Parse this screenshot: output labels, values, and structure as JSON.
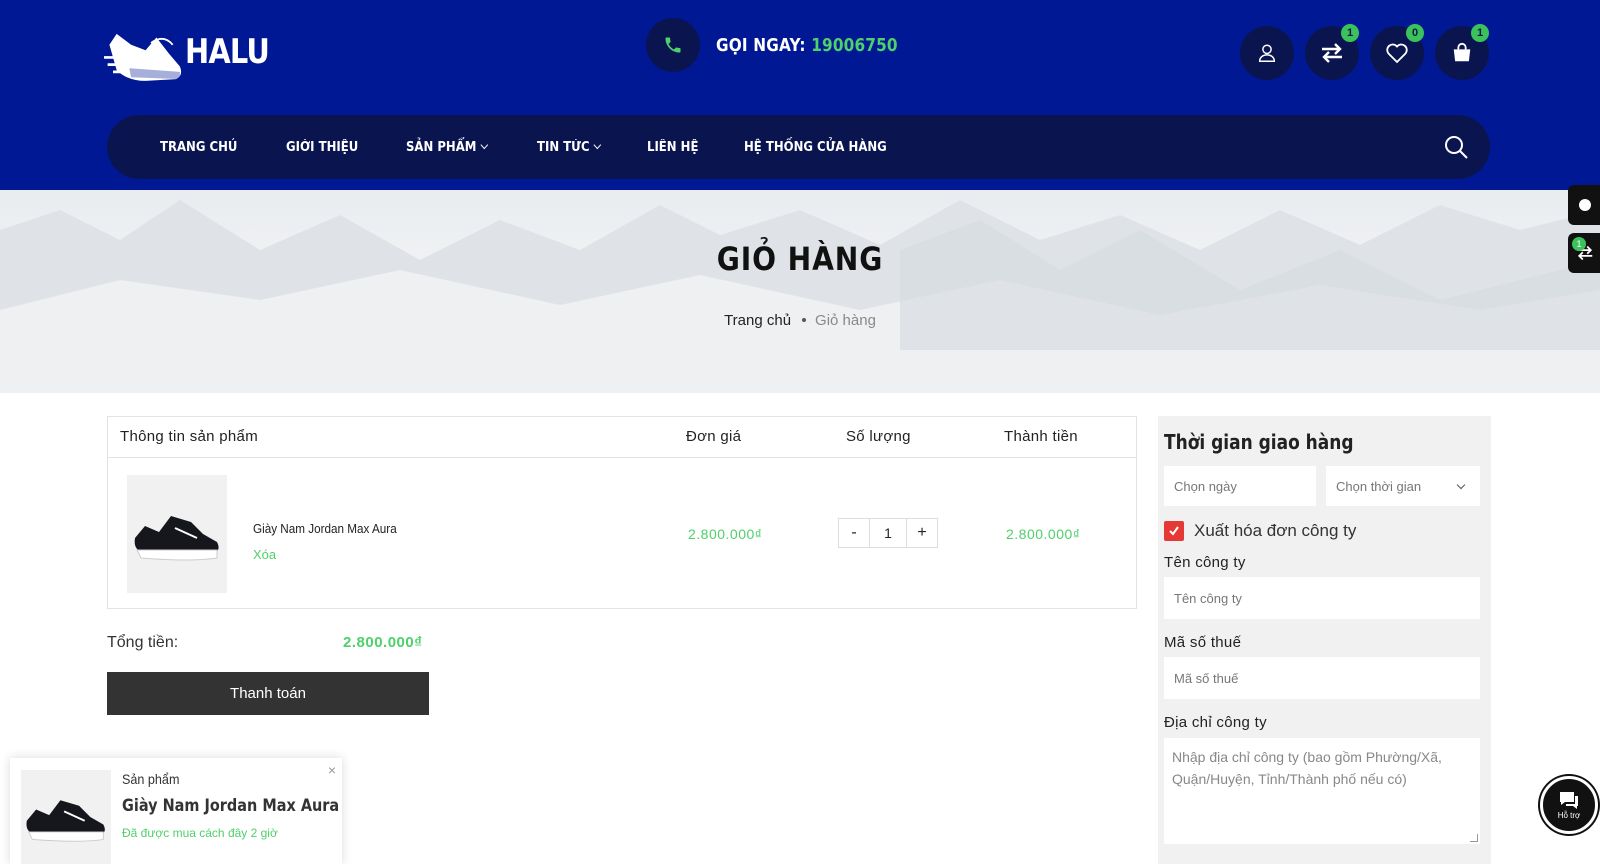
{
  "brand": {
    "name": "HALU"
  },
  "hotline": {
    "label": "GỌI NGAY:",
    "number": "19006750"
  },
  "header_icons": [
    {
      "icon": "user-icon",
      "badge": ""
    },
    {
      "icon": "compare-icon",
      "badge": "1"
    },
    {
      "icon": "heart-icon",
      "badge": "0"
    },
    {
      "icon": "bag-icon",
      "badge": "1"
    }
  ],
  "nav": {
    "items": [
      {
        "label": "TRANG CHỦ",
        "dropdown": false
      },
      {
        "label": "GIỚI THIỆU",
        "dropdown": false
      },
      {
        "label": "SẢN PHẨM",
        "dropdown": true
      },
      {
        "label": "TIN TỨC",
        "dropdown": true
      },
      {
        "label": "LIÊN HỆ",
        "dropdown": false
      },
      {
        "label": "HỆ THỐNG CỬA HÀNG",
        "dropdown": false
      }
    ]
  },
  "banner": {
    "title": "GIỎ HÀNG",
    "breadcrumb": {
      "home": "Trang chủ",
      "current": "Giỏ hàng"
    }
  },
  "side_widgets": {
    "compare_badge": "1"
  },
  "cart": {
    "headers": {
      "product": "Thông tin sản phẩm",
      "unit_price": "Đơn giá",
      "quantity": "Số lượng",
      "subtotal": "Thành tiền"
    },
    "item": {
      "name": "Giày Nam Jordan Max Aura",
      "remove": "Xóa",
      "unit_price": "2.800.000₫",
      "qty_minus": "-",
      "qty_plus": "+",
      "quantity": "1",
      "subtotal": "2.800.000₫"
    },
    "total_label": "Tổng tiền:",
    "total_value": "2.800.000₫",
    "checkout": "Thanh toán"
  },
  "delivery": {
    "title": "Thời gian giao hàng",
    "date_placeholder": "Chọn ngày",
    "time_select": "Chọn thời gian",
    "invoice_label": "Xuất hóa đơn công ty",
    "invoice_checked": true,
    "company_label": "Tên công ty",
    "company_placeholder": "Tên công ty",
    "tax_label": "Mã số thuế",
    "tax_placeholder": "Mã số thuế",
    "address_label": "Địa chỉ công ty",
    "address_placeholder": "Nhập địa chỉ công ty (bao gồm Phường/Xã, Quận/Huyện, Tỉnh/Thành phố nếu có)"
  },
  "toast": {
    "kicker": "Sản phẩm",
    "title": "Giày Nam Jordan Max Aura",
    "time": "Đã được mua cách đây 2 giờ",
    "close": "×"
  },
  "support": {
    "label": "Hỗ trợ"
  },
  "colors": {
    "header": "#001894",
    "nav": "#0a1550",
    "accent": "#4ed06a",
    "badge": "#3cc25a",
    "button": "#333333",
    "checkbox": "#e53935"
  }
}
